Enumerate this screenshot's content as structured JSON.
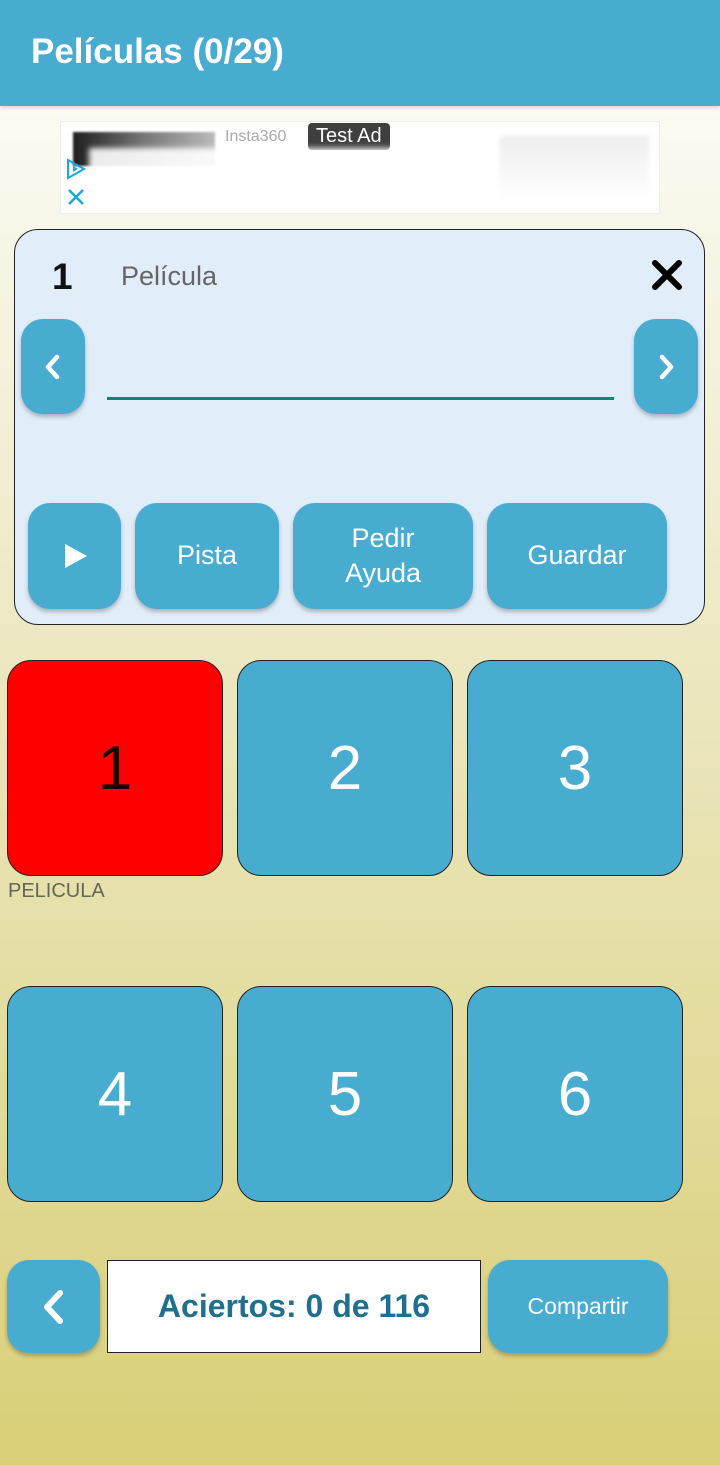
{
  "header": {
    "title": "Películas (0/29)"
  },
  "ad": {
    "brand": "Insta360",
    "badge": "Test Ad"
  },
  "question": {
    "number": "1",
    "category": "Película",
    "answer_value": "",
    "buttons": {
      "play_icon": "play-icon",
      "hint": "Pista",
      "ask_help_line1": "Pedir",
      "ask_help_line2": "Ayuda",
      "save": "Guardar"
    }
  },
  "tiles": [
    {
      "number": "1",
      "state": "selected",
      "color": "#ff0000"
    },
    {
      "number": "2",
      "state": "default",
      "color": "#48acd1"
    },
    {
      "number": "3",
      "state": "default",
      "color": "#48acd1"
    },
    {
      "number": "4",
      "state": "default",
      "color": "#48acd1"
    },
    {
      "number": "5",
      "state": "default",
      "color": "#48acd1"
    },
    {
      "number": "6",
      "state": "default",
      "color": "#48acd1"
    }
  ],
  "tile_caption": "PELICULA",
  "footer": {
    "score": "Aciertos: 0 de 116",
    "share": "Compartir"
  },
  "colors": {
    "accent": "#48acd1",
    "selected": "#ff0000",
    "underline": "#00897b",
    "score_text": "#1f6f8e"
  }
}
